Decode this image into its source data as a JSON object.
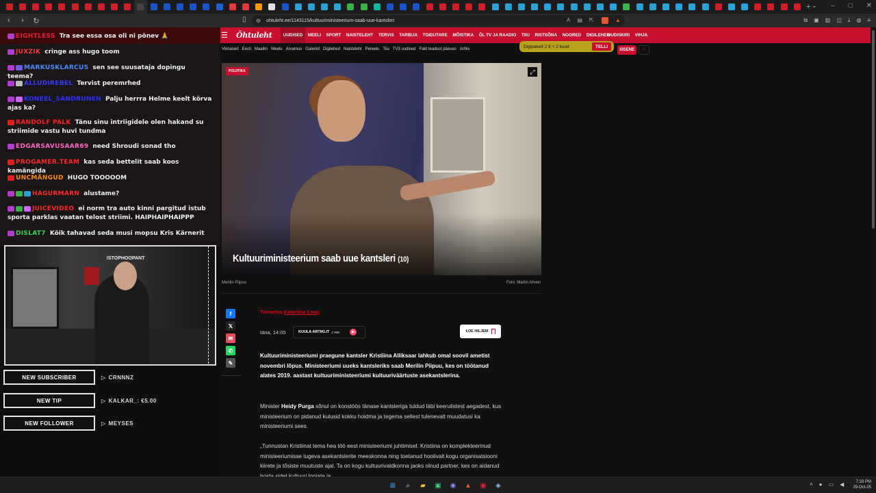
{
  "browser": {
    "url": "ohtuleht.ee/1143115/kultuuriministeerium-saab-uue-kantsleri",
    "tab_colors": [
      "#d0202a",
      "#d0202a",
      "#d0202a",
      "#d0202a",
      "#d0202a",
      "#d0202a",
      "#d0202a",
      "#d0202a",
      "#d0202a",
      "#d0202a",
      "#444",
      "#1a55c8",
      "#1a55c8",
      "#1a55c8",
      "#1a55c8",
      "#1a55c8",
      "#2060d0",
      "#e23a3a",
      "#e23a3a",
      "#ff9a00",
      "#e0e0e0",
      "#1a55c8",
      "#2da0d6",
      "#2da0d6",
      "#2da0d6",
      "#2da0d6",
      "#3ab04a",
      "#3ab04a",
      "#11b8a0",
      "#1a55c8",
      "#1a55c8",
      "#1a55c8",
      "#d0202a",
      "#d0202a",
      "#d0202a",
      "#d0202a",
      "#d0202a",
      "#2da0d6",
      "#2da0d6",
      "#2da0d6",
      "#2da0d6",
      "#2da0d6",
      "#2da0d6",
      "#2da0d6",
      "#2da0d6",
      "#2da0d6",
      "#2da0d6",
      "#3ab04a",
      "#2da0d6",
      "#2da0d6",
      "#2da0d6",
      "#2da0d6",
      "#2da0d6",
      "#2da0d6",
      "#d0202a",
      "#2da0d6",
      "#2da0d6",
      "#d0202a",
      "#d0202a",
      "#d0202a",
      "#d0202a"
    ],
    "new_tab": "+",
    "window_controls": [
      "⌄",
      "–",
      "□",
      "✕"
    ]
  },
  "stream": {
    "chat_messages": [
      {
        "user": "EIGHTLESS",
        "user_color": "#e3203b",
        "badges": [
          "#b43bd0"
        ],
        "text": "Tra see essa osa oli ni põnev 🙏"
      },
      {
        "user": "JUXZIK",
        "user_color": "#ff3b3b",
        "badges": [
          "#b43bd0"
        ],
        "text": "cringe ass hugo toom"
      },
      {
        "user": "MARKUSKLARCUS",
        "user_color": "#4c8cff",
        "badges": [
          "#b43bd0",
          "#6b5be8"
        ],
        "text": "sen see suusataja dopingu teema?"
      },
      {
        "user": "ALLUDIREBEL",
        "user_color": "#3a3aff",
        "badges": [
          "#b43bd0",
          "#bbb"
        ],
        "text": "Tervist peremrhed"
      },
      {
        "user": "KONEEL_SANDRUNEN",
        "user_color": "#3030ff",
        "badges": [
          "#b43bd0",
          "#cc66ff"
        ],
        "text": "Palju herrra Helme keelt kõrva ajas ka?"
      },
      {
        "user": "RANDOLF PALK",
        "user_color": "#ff2222",
        "badges": [
          "#e02020"
        ],
        "text": "Tänu sinu intriigidele olen hakand su striimide vastu huvi tundma"
      },
      {
        "user": "EDGARSAVUSAAR69",
        "user_color": "#ff66c4",
        "badges": [
          "#b43bd0"
        ],
        "text": "need Shroudi sonad tho"
      },
      {
        "user": "PROGAMER.TEAM",
        "user_color": "#ff2a2a",
        "badges": [
          "#e02020"
        ],
        "text": "kas seda bettelit saab koos kamängida"
      },
      {
        "user": "UNCMÄNGUD",
        "user_color": "#ff8a1a",
        "badges": [
          "#e02020"
        ],
        "text": "HUGO TOOOOOM"
      },
      {
        "user": "HAGURMARN",
        "user_color": "#ff2a2a",
        "badges": [
          "#b43bd0",
          "#3ab04a",
          "#2da0d6"
        ],
        "text": "alustame?"
      },
      {
        "user": "JUICEVIDEO",
        "user_color": "#ff2a2a",
        "badges": [
          "#b43bd0",
          "#3ab04a",
          "#cc66ff"
        ],
        "text": "ei norm tra auto kinni pargitud istub sporta parklas vaatan telost striimi. HAIPHAIPHAIPPP"
      },
      {
        "user": "DISLAT7",
        "user_color": "#3ad05a",
        "badges": [
          "#b43bd0"
        ],
        "text": "Kõik tahavad seda musi mopsu Kris Kärnerit"
      }
    ],
    "cam_label": "ISTOPHOOPANT",
    "alerts": [
      {
        "label": "NEW SUBSCRIBER",
        "value": "CRNNNZ"
      },
      {
        "label": "NEW TIP",
        "value": "KALKAR_: €5.00"
      },
      {
        "label": "NEW FOLLOWER",
        "value": "MEYSES"
      }
    ]
  },
  "site": {
    "logo": "Õhtuleht",
    "menu_icon": "hamburger-icon",
    "nav": [
      "UUDISED",
      "MEELI",
      "SPORT",
      "NAISTELEHT",
      "TERVIS",
      "TARBIJA",
      "TOIDUTARE",
      "MÕISTIKA",
      "ÕL TV JA RAADIO",
      "TIIU",
      "RISTSÕNA",
      "NOORED",
      "DIGILEHED"
    ],
    "nav_right": [
      "UUDISKIRI",
      "VIHJA"
    ],
    "subnav": [
      "Viimased",
      "Eesti",
      "Maailm",
      "Meelu",
      "Arvamus",
      "Galeriid",
      "Digilehed",
      "Naisteleht",
      "Pereelu",
      "Tiiu",
      "TV3 uudised",
      "Fakt teadust päevas",
      "Arhiiv"
    ],
    "promo": {
      "text": "Digipakett 2 € + 2 kuud",
      "button": "TELLI"
    },
    "login": "SISENE",
    "accent": "#c8102e"
  },
  "article": {
    "category": "POLIITIKA",
    "title": "Kultuuriministeerium saab uue kantsleri",
    "photo_count": "(10)",
    "caption_left": "Merilin Piipuu",
    "caption_right": "Foto: Martin Ahven",
    "author_prefix": "Toimetas",
    "author": "Katariina Loog",
    "date": "täna, 14:05",
    "listen_label": "KUULA ARTIKLIT",
    "listen_duration": "2 MIN",
    "read_later": "LOE HILJEM",
    "lead": "Kultuuriministeeriumi praegune kantsler Kristiina Alliksaar lahkub omal soovil ametist novembri lõpus. Ministeeriumi uueks kantsleriks saab Merilin Piipuu, kes on töötanud alates 2019. aastast kultuuriministeeriumi kultuuriväärtuste asekantslerina.",
    "para1_prefix": "Minister ",
    "para1_name": "Heidy Purga",
    "para1_rest": " sõnul on koostöös tänase kantsleriga tuldud läbi keerulistest aegadest, kus ministeerium on pidanud kulusid kokku hoidma ja tegema sellest tulenevalt muudatusi ka ministeeriumi sees.",
    "para2": "„Tunnustan Kristiinat tema hea töö eest ministeeriumi juhtimisel. Kristiina on komplekteerinud ministeeriumisse tugeva asekantslerite meeskonna ning toetanud hoolivalt kogu organisatsiooni kiirete ja tõsiste muutuste ajal. Ta on kogu kultuurivaldkonna jaoks olnud partner, kes on aidanud hoida sidet kultuuri loojate ja"
  },
  "taskbar": {
    "time": "7:33 PM",
    "date": "29-Oct-25"
  }
}
